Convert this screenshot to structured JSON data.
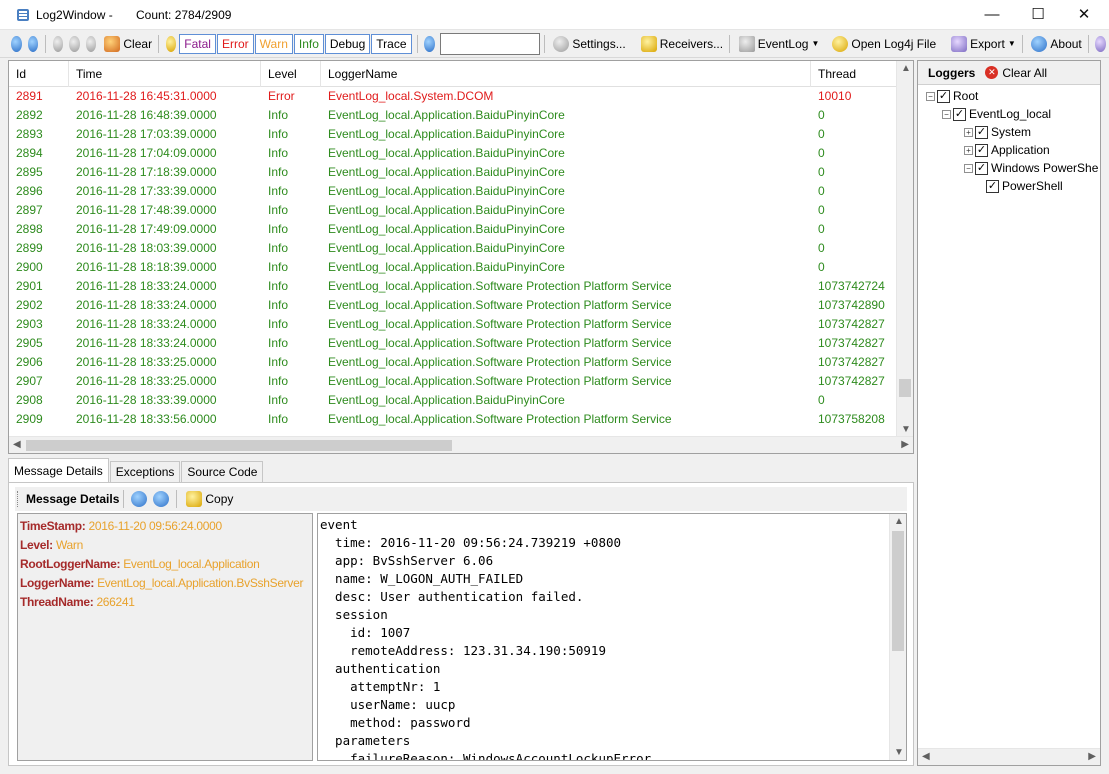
{
  "window": {
    "title": "Log2Window -",
    "count_text": "Count: 2784/2909",
    "minimize": "—",
    "maximize": "☐",
    "close": "✕"
  },
  "toolbar": {
    "clear": "Clear",
    "levels": [
      {
        "label": "Fatal",
        "color": "#8b1a8b"
      },
      {
        "label": "Error",
        "color": "#e01b1b"
      },
      {
        "label": "Warn",
        "color": "#f0a030"
      },
      {
        "label": "Info",
        "color": "#2e8b1e"
      },
      {
        "label": "Debug",
        "color": "#000000"
      },
      {
        "label": "Trace",
        "color": "#000000"
      }
    ],
    "search_value": "",
    "settings": "Settings...",
    "receivers": "Receivers...",
    "eventlog": "EventLog",
    "open_file": "Open Log4j File",
    "export": "Export",
    "about": "About"
  },
  "grid": {
    "columns": [
      "Id",
      "Time",
      "Level",
      "LoggerName",
      "Thread"
    ],
    "rows": [
      {
        "id": "2891",
        "time": "2016-11-28 16:45:31.0000",
        "level": "Error",
        "logger": "EventLog_local.System.DCOM",
        "thread": "10010"
      },
      {
        "id": "2892",
        "time": "2016-11-28 16:48:39.0000",
        "level": "Info",
        "logger": "EventLog_local.Application.BaiduPinyinCore",
        "thread": "0"
      },
      {
        "id": "2893",
        "time": "2016-11-28 17:03:39.0000",
        "level": "Info",
        "logger": "EventLog_local.Application.BaiduPinyinCore",
        "thread": "0"
      },
      {
        "id": "2894",
        "time": "2016-11-28 17:04:09.0000",
        "level": "Info",
        "logger": "EventLog_local.Application.BaiduPinyinCore",
        "thread": "0"
      },
      {
        "id": "2895",
        "time": "2016-11-28 17:18:39.0000",
        "level": "Info",
        "logger": "EventLog_local.Application.BaiduPinyinCore",
        "thread": "0"
      },
      {
        "id": "2896",
        "time": "2016-11-28 17:33:39.0000",
        "level": "Info",
        "logger": "EventLog_local.Application.BaiduPinyinCore",
        "thread": "0"
      },
      {
        "id": "2897",
        "time": "2016-11-28 17:48:39.0000",
        "level": "Info",
        "logger": "EventLog_local.Application.BaiduPinyinCore",
        "thread": "0"
      },
      {
        "id": "2898",
        "time": "2016-11-28 17:49:09.0000",
        "level": "Info",
        "logger": "EventLog_local.Application.BaiduPinyinCore",
        "thread": "0"
      },
      {
        "id": "2899",
        "time": "2016-11-28 18:03:39.0000",
        "level": "Info",
        "logger": "EventLog_local.Application.BaiduPinyinCore",
        "thread": "0"
      },
      {
        "id": "2900",
        "time": "2016-11-28 18:18:39.0000",
        "level": "Info",
        "logger": "EventLog_local.Application.BaiduPinyinCore",
        "thread": "0"
      },
      {
        "id": "2901",
        "time": "2016-11-28 18:33:24.0000",
        "level": "Info",
        "logger": "EventLog_local.Application.Software Protection Platform Service",
        "thread": "1073742724"
      },
      {
        "id": "2902",
        "time": "2016-11-28 18:33:24.0000",
        "level": "Info",
        "logger": "EventLog_local.Application.Software Protection Platform Service",
        "thread": "1073742890"
      },
      {
        "id": "2903",
        "time": "2016-11-28 18:33:24.0000",
        "level": "Info",
        "logger": "EventLog_local.Application.Software Protection Platform Service",
        "thread": "1073742827"
      },
      {
        "id": "2905",
        "time": "2016-11-28 18:33:24.0000",
        "level": "Info",
        "logger": "EventLog_local.Application.Software Protection Platform Service",
        "thread": "1073742827"
      },
      {
        "id": "2906",
        "time": "2016-11-28 18:33:25.0000",
        "level": "Info",
        "logger": "EventLog_local.Application.Software Protection Platform Service",
        "thread": "1073742827"
      },
      {
        "id": "2907",
        "time": "2016-11-28 18:33:25.0000",
        "level": "Info",
        "logger": "EventLog_local.Application.Software Protection Platform Service",
        "thread": "1073742827"
      },
      {
        "id": "2908",
        "time": "2016-11-28 18:33:39.0000",
        "level": "Info",
        "logger": "EventLog_local.Application.BaiduPinyinCore",
        "thread": "0"
      },
      {
        "id": "2909",
        "time": "2016-11-28 18:33:56.0000",
        "level": "Info",
        "logger": "EventLog_local.Application.Software Protection Platform Service",
        "thread": "1073758208"
      }
    ]
  },
  "loggers": {
    "title": "Loggers",
    "clear_all": "Clear All",
    "tree": [
      {
        "label": "Root",
        "expander": "−",
        "checked": true
      },
      {
        "label": "EventLog_local",
        "expander": "−",
        "checked": true
      },
      {
        "label": "System",
        "expander": "+",
        "checked": true
      },
      {
        "label": "Application",
        "expander": "+",
        "checked": true
      },
      {
        "label": "Windows PowerShe",
        "expander": "−",
        "checked": true
      },
      {
        "label": "PowerShell",
        "expander": "",
        "checked": true
      }
    ]
  },
  "tabs": [
    "Message Details",
    "Exceptions",
    "Source Code"
  ],
  "details": {
    "toolbar_title": "Message Details",
    "copy": "Copy",
    "props": [
      {
        "key": "TimeStamp:",
        "value": "2016-11-20 09:56:24.0000"
      },
      {
        "key": "Level:",
        "value": "Warn"
      },
      {
        "key": "RootLoggerName:",
        "value": "EventLog_local.Application"
      },
      {
        "key": "LoggerName:",
        "value": "EventLog_local.Application.BvSshServer"
      },
      {
        "key": "ThreadName:",
        "value": "266241"
      }
    ],
    "message": "event\n  time: 2016-11-20 09:56:24.739219 +0800\n  app: BvSshServer 6.06\n  name: W_LOGON_AUTH_FAILED\n  desc: User authentication failed.\n  session\n    id: 1007\n    remoteAddress: 123.31.34.190:50919\n  authentication\n    attemptNr: 1\n    userName: uucp\n    method: password\n  parameters\n    failureReason: WindowsAccountLockupError"
  },
  "scroll": {
    "grid_vertical_position": 0.93,
    "grid_horizontal_fraction": 0.49
  }
}
